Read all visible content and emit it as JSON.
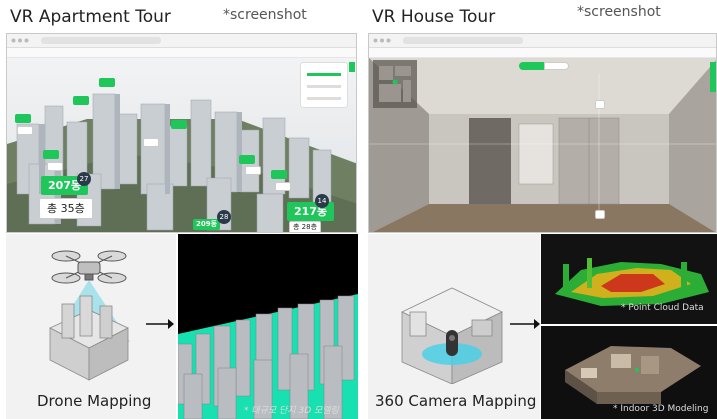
{
  "left": {
    "title": "VR Apartment Tour",
    "note": "*screenshot",
    "labels": {
      "block_207": "207동",
      "floors_35": "총 35층",
      "block_209": "209동",
      "block_217": "217동",
      "floors_28": "총 28층",
      "n27": "27",
      "n28": "28",
      "n14": "14"
    },
    "caption": "Drone Mapping",
    "model_note": "* 대규모 단지 3D 모델링"
  },
  "right": {
    "title": "VR House Tour",
    "note": "*screenshot",
    "caption": "360 Camera Mapping",
    "point_cloud_note": "* Point Cloud Data",
    "indoor_note": "* Indoor 3D Modeling"
  },
  "colors": {
    "accent_green": "#1fc65a",
    "mint": "#19e0b0"
  }
}
